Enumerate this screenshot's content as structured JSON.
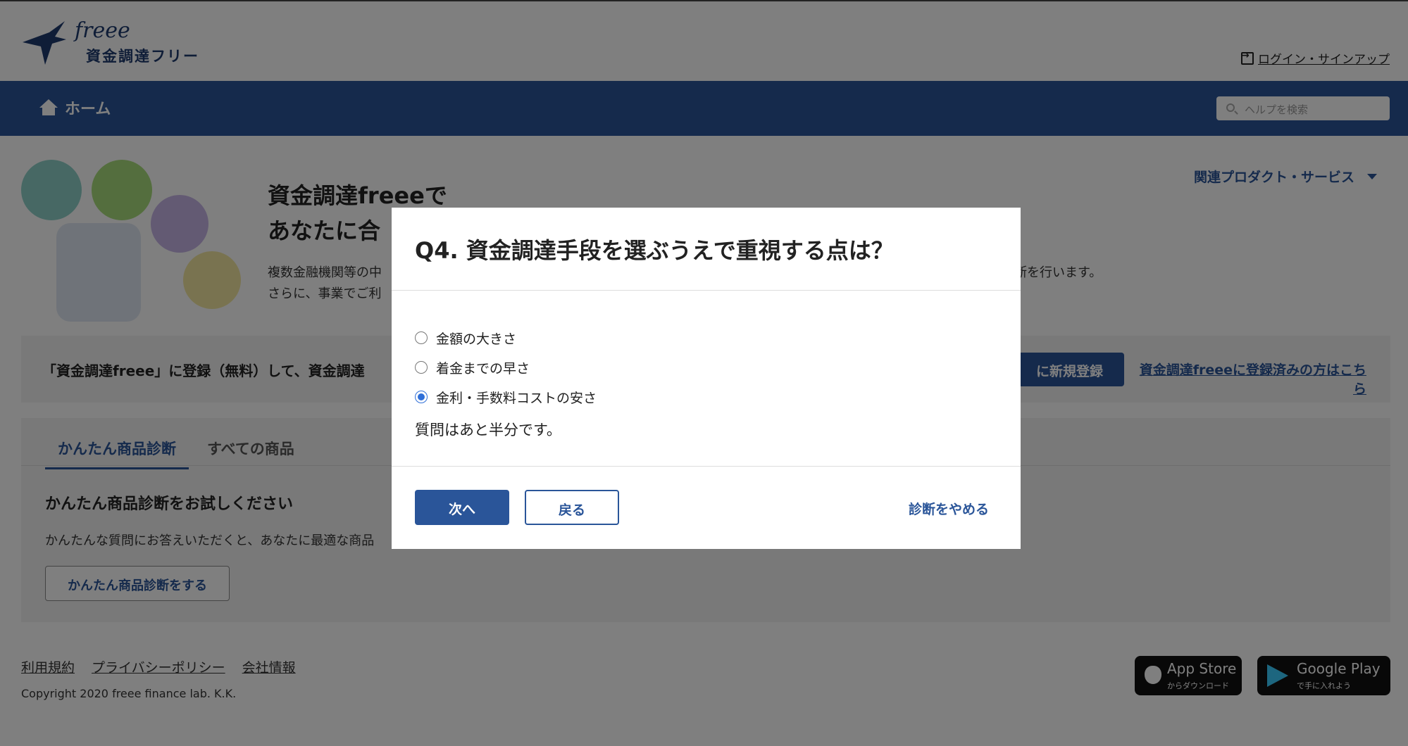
{
  "header": {
    "logo_wordmark": "freee",
    "logo_text": "資金調達フリー",
    "login_label": "ログイン・サインアップ"
  },
  "nav": {
    "home_label": "ホーム",
    "search_placeholder": "ヘルプを検索"
  },
  "hero": {
    "title_line1": "資金調達freeeで",
    "title_line2": "あなたに合",
    "desc_line1": "複数金融機関等の中",
    "desc_line1_end": "断を行います。",
    "desc_line2": "さらに、事業でご利",
    "related_label": "関連プロダクト・サービス"
  },
  "register_bar": {
    "text": "「資金調達freee」に登録（無料）して、資金調達",
    "button_label": "に新規登録",
    "link_label": "資金調達freeeに登録済みの方はこちら"
  },
  "tabs": [
    {
      "label": "かんたん商品診断"
    },
    {
      "label": "すべての商品"
    }
  ],
  "diagnosis": {
    "heading": "かんたん商品診断をお試しください",
    "desc": "かんたんな質問にお答えいただくと、あなたに最適な商品",
    "button_label": "かんたん商品診断をする"
  },
  "footer": {
    "links": [
      "利用規約",
      "プライバシーポリシー",
      "会社情報"
    ],
    "copyright": "Copyright 2020 freee finance lab. K.K.",
    "app_store_big": "App Store",
    "app_store_small": "からダウンロード",
    "google_play_big": "Google Play",
    "google_play_small": "で手に入れよう"
  },
  "modal": {
    "title": "Q4.  資金調達手段を選ぶうえで重視する点は？",
    "options": [
      {
        "label": "金額の大きさ",
        "selected": false
      },
      {
        "label": "着金までの早さ",
        "selected": false
      },
      {
        "label": "金利・手数料コストの安さ",
        "selected": true
      }
    ],
    "progress_message": "質問はあと半分です。",
    "next_label": "次へ",
    "back_label": "戻る",
    "quit_label": "診断をやめる"
  },
  "colors": {
    "brand": "#2a5599",
    "radio_selected": "#2f6fd8",
    "overlay": "rgba(0,0,0,0.5)"
  }
}
